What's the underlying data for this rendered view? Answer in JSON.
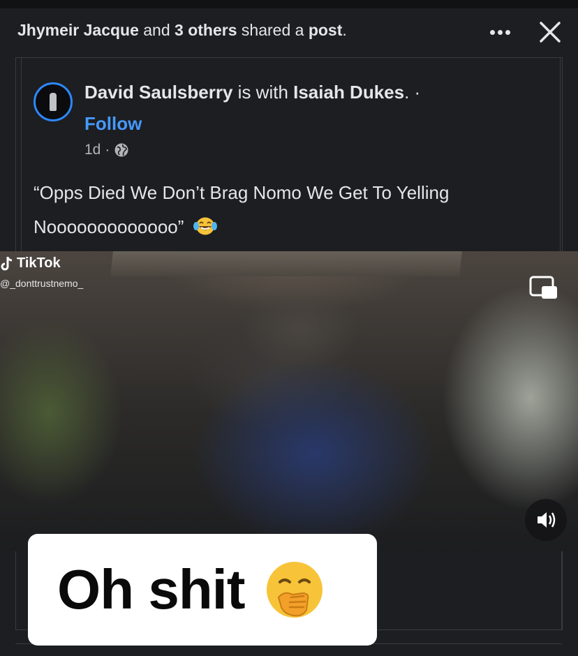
{
  "header": {
    "sharer_name": "Jhymeir Jacque",
    "connector": " and ",
    "others": "3 others",
    "action": " shared a ",
    "object": "post",
    "end": "."
  },
  "post": {
    "author": "David Saulsberry",
    "with_text": " is with ",
    "tagged": "Isaiah Dukes",
    "separator": ". ·",
    "follow_label": "Follow",
    "time": "1d",
    "time_sep": "·",
    "privacy_icon": "globe-icon",
    "text": "“Opps Died We Don’t Brag Nomo We Get To Yelling Nooooooooooooo”",
    "emoji": "face-with-tears-of-joy"
  },
  "video": {
    "watermark_brand": "TikTok",
    "watermark_user": "@_donttrustnemo_",
    "pip_icon": "picture-in-picture-icon",
    "sound_icon": "volume-on-icon",
    "caption": "Oh shit",
    "caption_emoji": "face-with-hand-over-mouth"
  },
  "colors": {
    "background": "#1d1e21",
    "text": "#e4e6eb",
    "muted": "#b0b3b8",
    "link": "#4599ff",
    "avatar_ring": "#2d88ff"
  }
}
